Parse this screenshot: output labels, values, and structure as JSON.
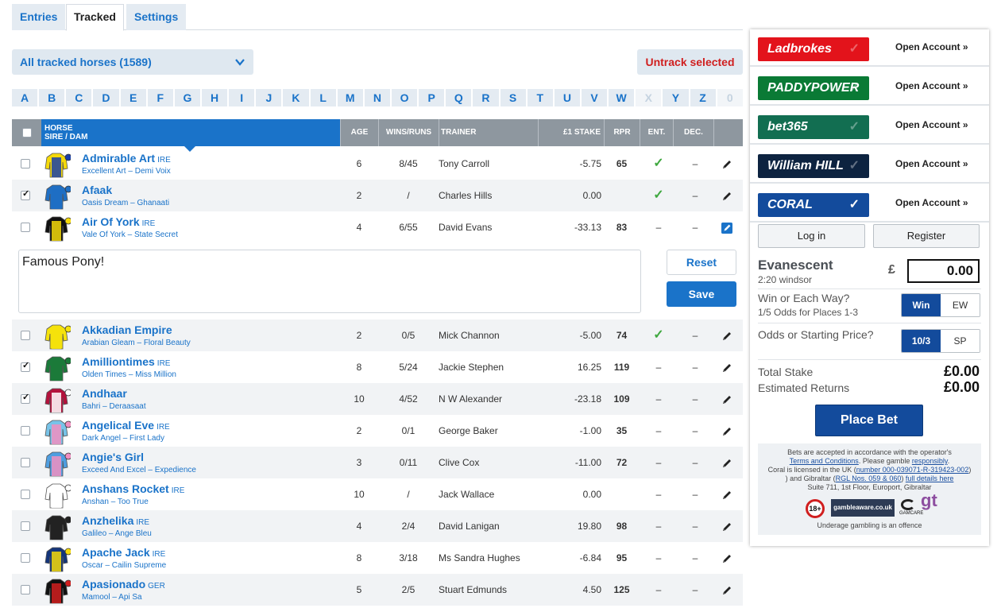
{
  "tabs": [
    "Entries",
    "Tracked",
    "Settings"
  ],
  "filter": {
    "label": "All tracked horses (1589)"
  },
  "untrack_label": "Untrack selected",
  "letters": [
    "A",
    "B",
    "C",
    "D",
    "E",
    "F",
    "G",
    "H",
    "I",
    "J",
    "K",
    "L",
    "M",
    "N",
    "O",
    "P",
    "Q",
    "R",
    "S",
    "T",
    "U",
    "V",
    "W",
    "X",
    "Y",
    "Z",
    "0"
  ],
  "table": {
    "headers": {
      "horse": "HORSE",
      "sire_dam": "SIRE / DAM",
      "age": "AGE",
      "wins_runs": "WINS/RUNS",
      "trainer": "TRAINER",
      "stake": "£1 STAKE",
      "rpr": "RPR",
      "ent": "ENT.",
      "dec": "DEC."
    },
    "rows": [
      {
        "name": "Admirable Art",
        "country": "IRE",
        "sire": "Excellent Art",
        "dam": "Demi Voix",
        "age": "6",
        "wins_runs": "8/45",
        "trainer": "Tony Carroll",
        "stake": "-5.75",
        "rpr": "65",
        "ent": "✓",
        "dec": "–",
        "checked": false
      },
      {
        "name": "Afaak",
        "country": "",
        "sire": "Oasis Dream",
        "dam": "Ghanaati",
        "age": "2",
        "wins_runs": "/",
        "trainer": "Charles Hills",
        "stake": "0.00",
        "rpr": "",
        "ent": "✓",
        "dec": "–",
        "checked": true
      },
      {
        "name": "Air Of York",
        "country": "IRE",
        "sire": "Vale Of York",
        "dam": "State Secret",
        "age": "4",
        "wins_runs": "6/55",
        "trainer": "David Evans",
        "stake": "-33.13",
        "rpr": "83",
        "ent": "–",
        "dec": "–",
        "checked": false
      },
      {
        "name": "Akkadian Empire",
        "country": "",
        "sire": "Arabian Gleam",
        "dam": "Floral Beauty",
        "age": "2",
        "wins_runs": "0/5",
        "trainer": "Mick Channon",
        "stake": "-5.00",
        "rpr": "74",
        "ent": "✓",
        "dec": "–",
        "checked": false
      },
      {
        "name": "Amilliontimes",
        "country": "IRE",
        "sire": "Olden Times",
        "dam": "Miss Million",
        "age": "8",
        "wins_runs": "5/24",
        "trainer": "Jackie Stephen",
        "stake": "16.25",
        "rpr": "119",
        "ent": "–",
        "dec": "–",
        "checked": true
      },
      {
        "name": "Andhaar",
        "country": "",
        "sire": "Bahri",
        "dam": "Deraasaat",
        "age": "10",
        "wins_runs": "4/52",
        "trainer": "N W Alexander",
        "stake": "-23.18",
        "rpr": "109",
        "ent": "–",
        "dec": "–",
        "checked": true
      },
      {
        "name": "Angelical Eve",
        "country": "IRE",
        "sire": "Dark Angel",
        "dam": "First Lady",
        "age": "2",
        "wins_runs": "0/1",
        "trainer": "George Baker",
        "stake": "-1.00",
        "rpr": "35",
        "ent": "–",
        "dec": "–",
        "checked": false
      },
      {
        "name": "Angie's Girl",
        "country": "",
        "sire": "Exceed And Excel",
        "dam": "Expedience",
        "age": "3",
        "wins_runs": "0/11",
        "trainer": "Clive Cox",
        "stake": "-11.00",
        "rpr": "72",
        "ent": "–",
        "dec": "–",
        "checked": false
      },
      {
        "name": "Anshans Rocket",
        "country": "IRE",
        "sire": "Anshan",
        "dam": "Too True",
        "age": "10",
        "wins_runs": "/",
        "trainer": "Jack Wallace",
        "stake": "0.00",
        "rpr": "",
        "ent": "–",
        "dec": "–",
        "checked": false
      },
      {
        "name": "Anzhelika",
        "country": "IRE",
        "sire": "Galileo",
        "dam": "Ange Bleu",
        "age": "4",
        "wins_runs": "2/4",
        "trainer": "David Lanigan",
        "stake": "19.80",
        "rpr": "98",
        "ent": "–",
        "dec": "–",
        "checked": false
      },
      {
        "name": "Apache Jack",
        "country": "IRE",
        "sire": "Oscar",
        "dam": "Cailin Supreme",
        "age": "8",
        "wins_runs": "3/18",
        "trainer": "Ms Sandra Hughes",
        "stake": "-6.84",
        "rpr": "95",
        "ent": "–",
        "dec": "–",
        "checked": false
      },
      {
        "name": "Apasionado",
        "country": "GER",
        "sire": "Mamool",
        "dam": "Api Sa",
        "age": "5",
        "wins_runs": "2/5",
        "trainer": "Stuart Edmunds",
        "stake": "4.50",
        "rpr": "125",
        "ent": "–",
        "dec": "–",
        "checked": false
      }
    ]
  },
  "note": {
    "text": "Famous Pony!",
    "reset_label": "Reset",
    "save_label": "Save"
  },
  "bookmakers": [
    {
      "name": "Ladbrokes",
      "color": "#e3131b",
      "open_label": "Open Account »"
    },
    {
      "name": "PADDYPOWER",
      "color": "#0a7a35",
      "open_label": "Open Account »"
    },
    {
      "name": "bet365",
      "color": "#126e51",
      "open_label": "Open Account »"
    },
    {
      "name": "William HILL",
      "color": "#0d2340",
      "open_label": "Open Account »"
    },
    {
      "name": "CORAL",
      "color": "#134b9c",
      "open_label": "Open Account »"
    }
  ],
  "account": {
    "login_label": "Log in",
    "register_label": "Register"
  },
  "betslip": {
    "selection": "Evanescent",
    "race": "2:20 windsor",
    "currency": "£",
    "stake": "0.00",
    "win_ew_label": "Win or Each Way?",
    "ew_terms": "1/5 Odds for Places 1-3",
    "win_option": "Win",
    "ew_option": "EW",
    "odds_label": "Odds or Starting Price?",
    "odds_option": "10/3",
    "sp_option": "SP",
    "total_stake_label": "Total Stake",
    "total_stake": "£0.00",
    "returns_label": "Estimated Returns",
    "returns": "£0.00",
    "place_label": "Place Bet"
  },
  "legal": {
    "line1": "Bets are accepted in accordance with the operator's",
    "terms_link": "Terms and Conditions",
    "line2": ". Please gamble ",
    "responsibly": "responsibly",
    "line3": "Coral is licensed in the UK (",
    "uk_license": "number 000-039071-R-319423-002",
    "line4": ") and Gibraltar (",
    "gib_license": "RGL Nos. 059 & 060",
    "line5": ") ",
    "full_details": "full details here",
    "address": "Suite 711, 1st Floor, Europort, Gibraltar",
    "age_badge": "18+",
    "gambleaware": "gambleaware.co.uk",
    "gamcare": "GAMCARE",
    "gt": "gt",
    "underage": "Underage gambling is an offence"
  }
}
